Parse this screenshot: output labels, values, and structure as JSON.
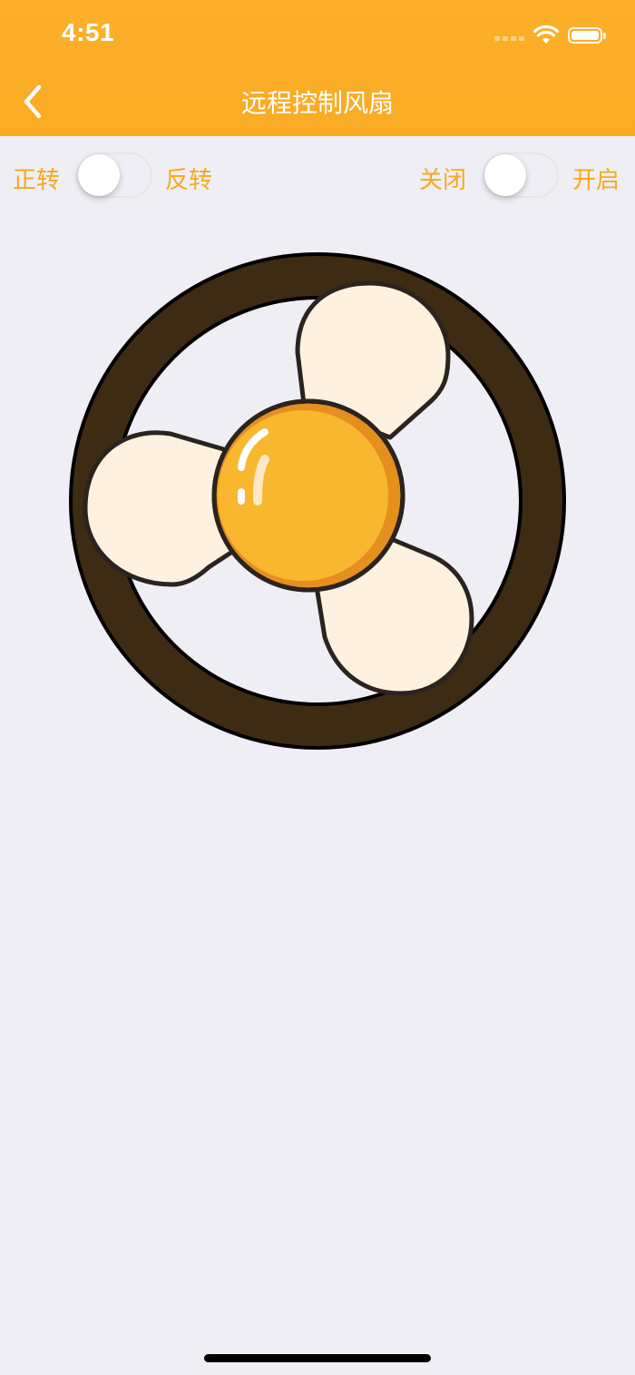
{
  "status_bar": {
    "time": "4:51"
  },
  "nav": {
    "title": "远程控制风扇",
    "back_icon": "chevron-left-icon"
  },
  "direction": {
    "label_left": "正转",
    "label_right": "反转",
    "is_on": false
  },
  "power": {
    "label_left": "关闭",
    "label_right": "开启",
    "is_on": false
  },
  "colors": {
    "header": "#fdb02a",
    "accent_text": "#f8a81e",
    "background": "#efeef4",
    "fan_ring": "#3e2b14",
    "fan_blade": "#fff1e0",
    "fan_hub": "#f8b72e"
  },
  "fan": {
    "icon": "fan-icon"
  }
}
